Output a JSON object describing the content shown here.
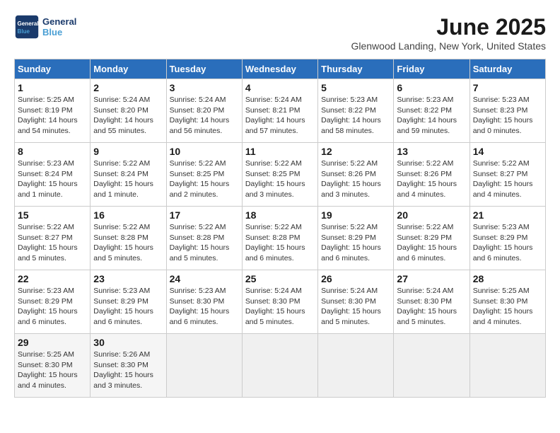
{
  "header": {
    "logo_line1": "General",
    "logo_line2": "Blue",
    "month_title": "June 2025",
    "location": "Glenwood Landing, New York, United States"
  },
  "days_of_week": [
    "Sunday",
    "Monday",
    "Tuesday",
    "Wednesday",
    "Thursday",
    "Friday",
    "Saturday"
  ],
  "weeks": [
    [
      {
        "day": "1",
        "info": "Sunrise: 5:25 AM\nSunset: 8:19 PM\nDaylight: 14 hours\nand 54 minutes."
      },
      {
        "day": "2",
        "info": "Sunrise: 5:24 AM\nSunset: 8:20 PM\nDaylight: 14 hours\nand 55 minutes."
      },
      {
        "day": "3",
        "info": "Sunrise: 5:24 AM\nSunset: 8:20 PM\nDaylight: 14 hours\nand 56 minutes."
      },
      {
        "day": "4",
        "info": "Sunrise: 5:24 AM\nSunset: 8:21 PM\nDaylight: 14 hours\nand 57 minutes."
      },
      {
        "day": "5",
        "info": "Sunrise: 5:23 AM\nSunset: 8:22 PM\nDaylight: 14 hours\nand 58 minutes."
      },
      {
        "day": "6",
        "info": "Sunrise: 5:23 AM\nSunset: 8:22 PM\nDaylight: 14 hours\nand 59 minutes."
      },
      {
        "day": "7",
        "info": "Sunrise: 5:23 AM\nSunset: 8:23 PM\nDaylight: 15 hours\nand 0 minutes."
      }
    ],
    [
      {
        "day": "8",
        "info": "Sunrise: 5:23 AM\nSunset: 8:24 PM\nDaylight: 15 hours\nand 1 minute."
      },
      {
        "day": "9",
        "info": "Sunrise: 5:22 AM\nSunset: 8:24 PM\nDaylight: 15 hours\nand 1 minute."
      },
      {
        "day": "10",
        "info": "Sunrise: 5:22 AM\nSunset: 8:25 PM\nDaylight: 15 hours\nand 2 minutes."
      },
      {
        "day": "11",
        "info": "Sunrise: 5:22 AM\nSunset: 8:25 PM\nDaylight: 15 hours\nand 3 minutes."
      },
      {
        "day": "12",
        "info": "Sunrise: 5:22 AM\nSunset: 8:26 PM\nDaylight: 15 hours\nand 3 minutes."
      },
      {
        "day": "13",
        "info": "Sunrise: 5:22 AM\nSunset: 8:26 PM\nDaylight: 15 hours\nand 4 minutes."
      },
      {
        "day": "14",
        "info": "Sunrise: 5:22 AM\nSunset: 8:27 PM\nDaylight: 15 hours\nand 4 minutes."
      }
    ],
    [
      {
        "day": "15",
        "info": "Sunrise: 5:22 AM\nSunset: 8:27 PM\nDaylight: 15 hours\nand 5 minutes."
      },
      {
        "day": "16",
        "info": "Sunrise: 5:22 AM\nSunset: 8:28 PM\nDaylight: 15 hours\nand 5 minutes."
      },
      {
        "day": "17",
        "info": "Sunrise: 5:22 AM\nSunset: 8:28 PM\nDaylight: 15 hours\nand 5 minutes."
      },
      {
        "day": "18",
        "info": "Sunrise: 5:22 AM\nSunset: 8:28 PM\nDaylight: 15 hours\nand 6 minutes."
      },
      {
        "day": "19",
        "info": "Sunrise: 5:22 AM\nSunset: 8:29 PM\nDaylight: 15 hours\nand 6 minutes."
      },
      {
        "day": "20",
        "info": "Sunrise: 5:22 AM\nSunset: 8:29 PM\nDaylight: 15 hours\nand 6 minutes."
      },
      {
        "day": "21",
        "info": "Sunrise: 5:23 AM\nSunset: 8:29 PM\nDaylight: 15 hours\nand 6 minutes."
      }
    ],
    [
      {
        "day": "22",
        "info": "Sunrise: 5:23 AM\nSunset: 8:29 PM\nDaylight: 15 hours\nand 6 minutes."
      },
      {
        "day": "23",
        "info": "Sunrise: 5:23 AM\nSunset: 8:29 PM\nDaylight: 15 hours\nand 6 minutes."
      },
      {
        "day": "24",
        "info": "Sunrise: 5:23 AM\nSunset: 8:30 PM\nDaylight: 15 hours\nand 6 minutes."
      },
      {
        "day": "25",
        "info": "Sunrise: 5:24 AM\nSunset: 8:30 PM\nDaylight: 15 hours\nand 5 minutes."
      },
      {
        "day": "26",
        "info": "Sunrise: 5:24 AM\nSunset: 8:30 PM\nDaylight: 15 hours\nand 5 minutes."
      },
      {
        "day": "27",
        "info": "Sunrise: 5:24 AM\nSunset: 8:30 PM\nDaylight: 15 hours\nand 5 minutes."
      },
      {
        "day": "28",
        "info": "Sunrise: 5:25 AM\nSunset: 8:30 PM\nDaylight: 15 hours\nand 4 minutes."
      }
    ],
    [
      {
        "day": "29",
        "info": "Sunrise: 5:25 AM\nSunset: 8:30 PM\nDaylight: 15 hours\nand 4 minutes."
      },
      {
        "day": "30",
        "info": "Sunrise: 5:26 AM\nSunset: 8:30 PM\nDaylight: 15 hours\nand 3 minutes."
      },
      {
        "day": "",
        "info": ""
      },
      {
        "day": "",
        "info": ""
      },
      {
        "day": "",
        "info": ""
      },
      {
        "day": "",
        "info": ""
      },
      {
        "day": "",
        "info": ""
      }
    ]
  ]
}
